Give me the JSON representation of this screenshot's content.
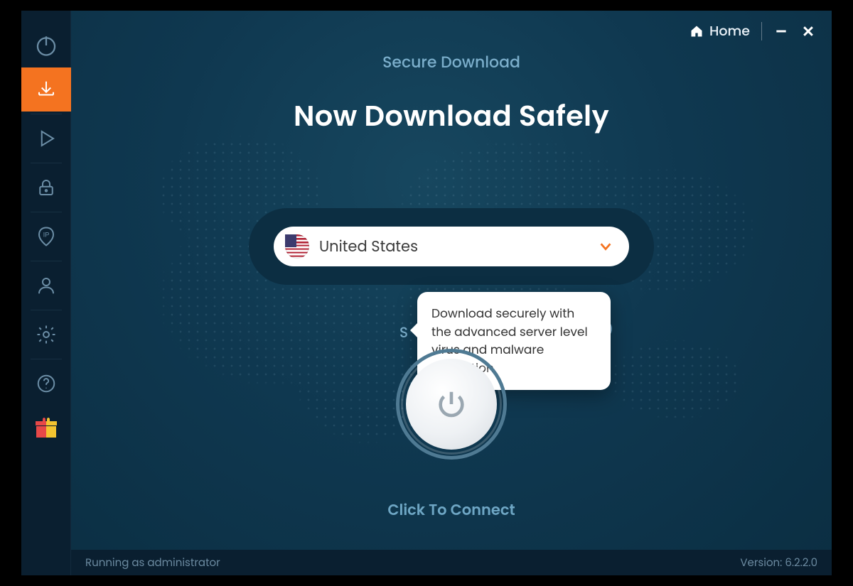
{
  "header": {
    "home_label": "Home"
  },
  "sidebar": {
    "items": [
      {
        "name": "power"
      },
      {
        "name": "download",
        "active": true
      },
      {
        "name": "play"
      },
      {
        "name": "lock"
      },
      {
        "name": "ip"
      },
      {
        "name": "profile"
      },
      {
        "name": "settings"
      },
      {
        "name": "help"
      },
      {
        "name": "gift"
      }
    ]
  },
  "main": {
    "subtitle": "Secure Download",
    "title": "Now Download Safely",
    "country_selected": "United States",
    "hidden_row_peek": "S",
    "tooltip_text": "Download securely with the advanced server level virus and malware protection",
    "connect_label": "Click To Connect"
  },
  "footer": {
    "status": "Running as administrator",
    "version_label": "Version:  6.2.2.0"
  },
  "colors": {
    "accent": "#f47320",
    "link": "#7baecb"
  }
}
